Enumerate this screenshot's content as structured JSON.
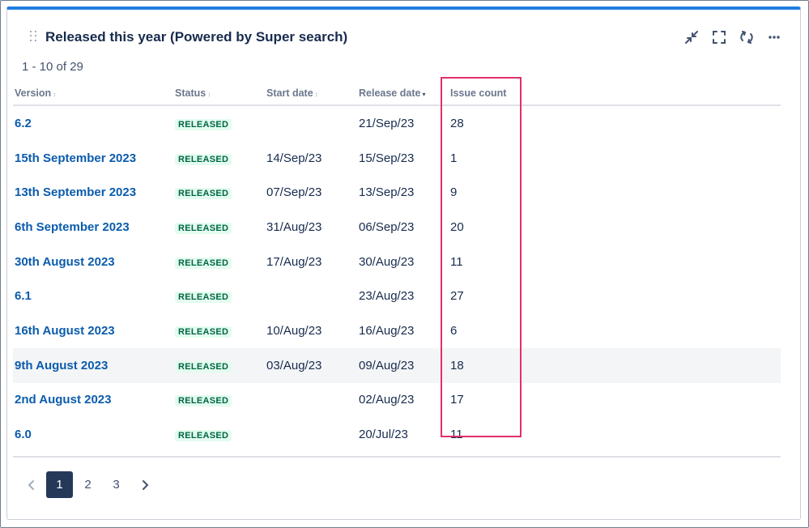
{
  "gadget": {
    "title": "Released this year (Powered by Super search)",
    "actions": [
      {
        "name": "minimize-icon"
      },
      {
        "name": "fullscreen-icon"
      },
      {
        "name": "refresh-icon"
      },
      {
        "name": "more-icon"
      }
    ]
  },
  "results": {
    "range_text": "1 - 10 of 29"
  },
  "table": {
    "columns": [
      {
        "label": "Version",
        "sort": "both"
      },
      {
        "label": "Status",
        "sort": "both"
      },
      {
        "label": "Start date",
        "sort": "both"
      },
      {
        "label": "Release date",
        "sort": "desc"
      },
      {
        "label": "Issue count",
        "sort": "none"
      }
    ],
    "rows": [
      {
        "version": "6.2",
        "status": "RELEASED",
        "start": "",
        "release": "21/Sep/23",
        "issues": "28"
      },
      {
        "version": "15th September 2023",
        "status": "RELEASED",
        "start": "14/Sep/23",
        "release": "15/Sep/23",
        "issues": "1"
      },
      {
        "version": "13th September 2023",
        "status": "RELEASED",
        "start": "07/Sep/23",
        "release": "13/Sep/23",
        "issues": "9"
      },
      {
        "version": "6th September 2023",
        "status": "RELEASED",
        "start": "31/Aug/23",
        "release": "06/Sep/23",
        "issues": "20"
      },
      {
        "version": "30th August 2023",
        "status": "RELEASED",
        "start": "17/Aug/23",
        "release": "30/Aug/23",
        "issues": "11"
      },
      {
        "version": "6.1",
        "status": "RELEASED",
        "start": "",
        "release": "23/Aug/23",
        "issues": "27"
      },
      {
        "version": "16th August 2023",
        "status": "RELEASED",
        "start": "10/Aug/23",
        "release": "16/Aug/23",
        "issues": "6"
      },
      {
        "version": "9th August 2023",
        "status": "RELEASED",
        "start": "03/Aug/23",
        "release": "09/Aug/23",
        "issues": "18"
      },
      {
        "version": "2nd August 2023",
        "status": "RELEASED",
        "start": "",
        "release": "02/Aug/23",
        "issues": "17"
      },
      {
        "version": "6.0",
        "status": "RELEASED",
        "start": "",
        "release": "20/Jul/23",
        "issues": "11"
      }
    ],
    "highlighted_row": 7
  },
  "pagination": {
    "pages": [
      "1",
      "2",
      "3"
    ],
    "current": "1",
    "prev_icon": "chevron-left-icon",
    "next_icon": "chevron-right-icon"
  },
  "colors": {
    "accent": "#1f7fe0",
    "link": "#0b5cad",
    "lozenge_bg": "#e3fcef",
    "lozenge_text": "#006644",
    "annotation_box": "#e0316a",
    "active_page": "#253858"
  }
}
